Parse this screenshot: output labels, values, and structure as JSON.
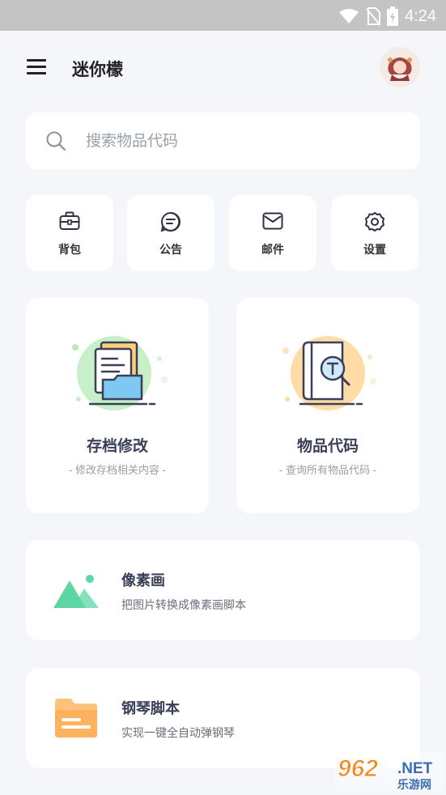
{
  "status_bar": {
    "time": "4:24"
  },
  "app_bar": {
    "title": "迷你檬"
  },
  "search": {
    "placeholder": "搜索物品代码"
  },
  "quick_actions": [
    {
      "label": "背包",
      "icon": "backpack-icon"
    },
    {
      "label": "公告",
      "icon": "announcement-icon"
    },
    {
      "label": "邮件",
      "icon": "mail-icon"
    },
    {
      "label": "设置",
      "icon": "gear-icon"
    }
  ],
  "feature_cards": [
    {
      "title": "存档修改",
      "subtitle": "- 修改存档相关内容 -",
      "icon": "folder-document-icon",
      "accent": "#a6e6a8"
    },
    {
      "title": "物品代码",
      "subtitle": "- 查询所有物品代码 -",
      "icon": "book-search-icon",
      "accent": "#ffd79a"
    }
  ],
  "tools": [
    {
      "title": "像素画",
      "subtitle": "把图片转换成像素画脚本",
      "icon": "mountain-image-icon",
      "accent": "#5ed6a4"
    },
    {
      "title": "钢琴脚本",
      "subtitle": "实现一键全自动弹钢琴",
      "icon": "folder-icon",
      "accent": "#ffc27a"
    }
  ],
  "watermark": {
    "brand": "962",
    "suffix": ".NET",
    "caption": "乐游网"
  }
}
